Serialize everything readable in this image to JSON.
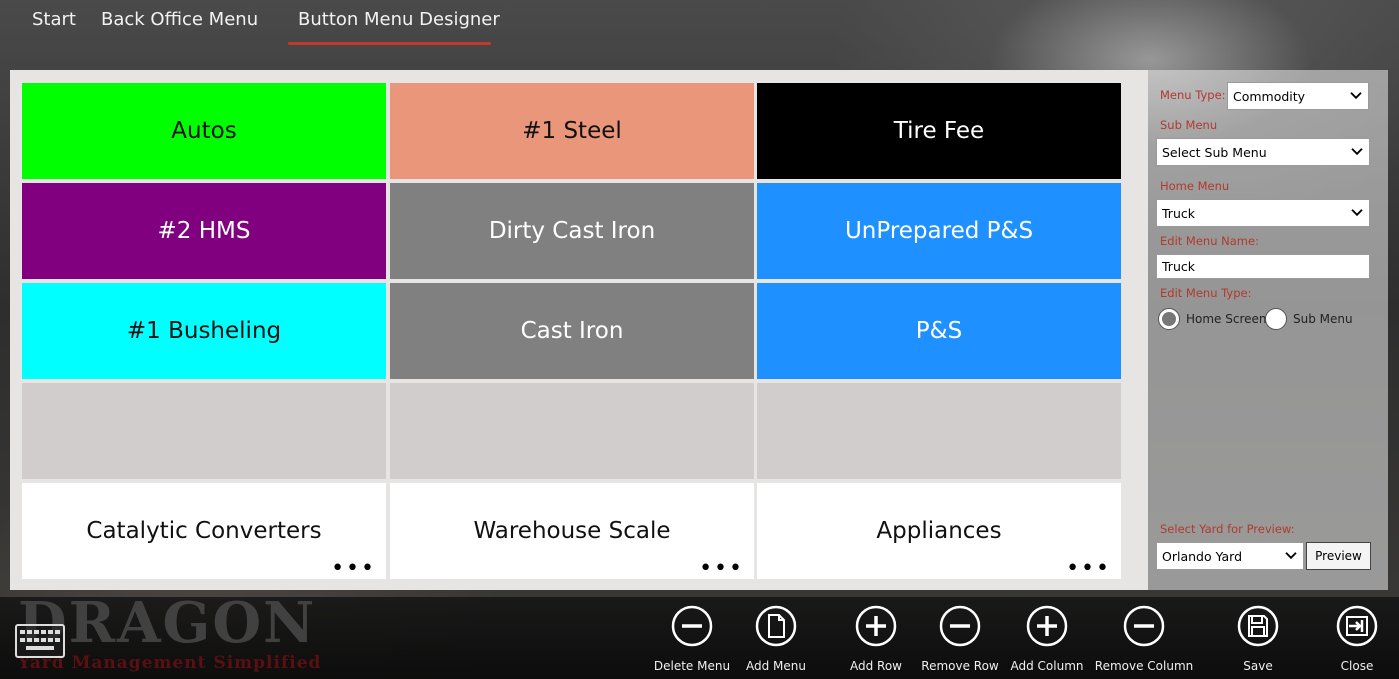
{
  "nav": {
    "start": "Start",
    "back_office": "Back Office Menu",
    "designer": "Button Menu Designer"
  },
  "grid": {
    "cells": [
      {
        "label": "Autos",
        "bg": "#00ff00",
        "fg": "#111111",
        "dots": false
      },
      {
        "label": "#1 Steel",
        "bg": "#e9967a",
        "fg": "#111111",
        "dots": false
      },
      {
        "label": "Tire Fee",
        "bg": "#000000",
        "fg": "#ffffff",
        "dots": false
      },
      {
        "label": "#2 HMS",
        "bg": "#800080",
        "fg": "#ffffff",
        "dots": false
      },
      {
        "label": "Dirty Cast Iron",
        "bg": "#808080",
        "fg": "#ffffff",
        "dots": false
      },
      {
        "label": "UnPrepared P&S",
        "bg": "#1e90ff",
        "fg": "#ffffff",
        "dots": false
      },
      {
        "label": "#1 Busheling",
        "bg": "#00ffff",
        "fg": "#111111",
        "dots": false
      },
      {
        "label": "Cast Iron",
        "bg": "#808080",
        "fg": "#ffffff",
        "dots": false
      },
      {
        "label": "P&S",
        "bg": "#1e90ff",
        "fg": "#ffffff",
        "dots": false
      },
      {
        "label": "",
        "bg": "#d0cdcc",
        "fg": "#111111",
        "dots": false
      },
      {
        "label": "",
        "bg": "#d0cdcc",
        "fg": "#111111",
        "dots": false
      },
      {
        "label": "",
        "bg": "#d0cdcc",
        "fg": "#111111",
        "dots": false
      },
      {
        "label": "Catalytic Converters",
        "bg": "#ffffff",
        "fg": "#111111",
        "dots": true
      },
      {
        "label": "Warehouse Scale",
        "bg": "#ffffff",
        "fg": "#111111",
        "dots": true
      },
      {
        "label": "Appliances",
        "bg": "#ffffff",
        "fg": "#111111",
        "dots": true
      }
    ],
    "dots_text": "•••"
  },
  "side": {
    "menu_type_label": "Menu Type:",
    "menu_type_value": "Commodity",
    "sub_menu_label": "Sub Menu",
    "sub_menu_value": "Select Sub Menu",
    "home_menu_label": "Home Menu",
    "home_menu_value": "Truck",
    "edit_name_label": "Edit Menu Name:",
    "edit_name_value": "Truck",
    "edit_type_label": "Edit Menu Type:",
    "radio_home": "Home Screen",
    "radio_sub": "Sub Menu",
    "yard_label": "Select Yard for Preview:",
    "yard_value": "Orlando Yard",
    "preview_button": "Preview",
    "label_color": "#b03a2e"
  },
  "logo": {
    "big": "DRAGON",
    "small": "Yard Management Simplified"
  },
  "actions": [
    {
      "label": "Delete Menu",
      "icon": "minus-circle-icon"
    },
    {
      "label": "Add Menu",
      "icon": "page-icon"
    },
    {
      "label": "Add Row",
      "icon": "plus-circle-icon"
    },
    {
      "label": "Remove Row",
      "icon": "minus-circle-icon"
    },
    {
      "label": "Add Column",
      "icon": "plus-circle-icon"
    },
    {
      "label": "Remove Column",
      "icon": "minus-circle-icon"
    },
    {
      "label": "Save",
      "icon": "save-icon"
    },
    {
      "label": "Close",
      "icon": "exit-icon"
    }
  ]
}
